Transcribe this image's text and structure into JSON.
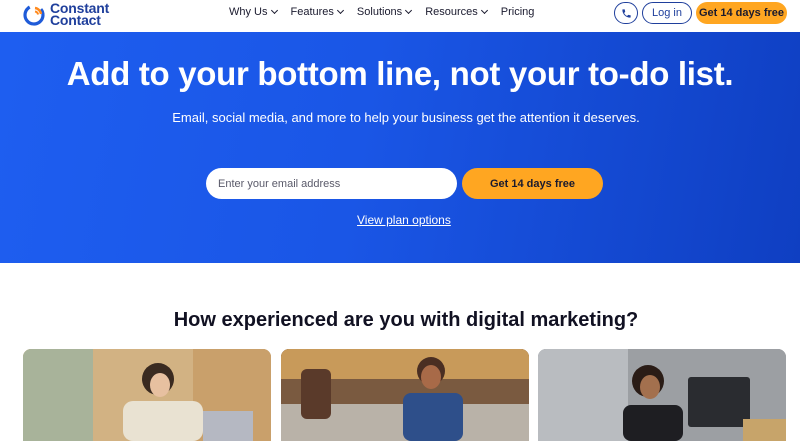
{
  "logo": {
    "line1": "Constant",
    "line2": "Contact"
  },
  "nav": [
    {
      "label": "Why Us",
      "has_dropdown": true
    },
    {
      "label": "Features",
      "has_dropdown": true
    },
    {
      "label": "Solutions",
      "has_dropdown": true
    },
    {
      "label": "Resources",
      "has_dropdown": true
    },
    {
      "label": "Pricing",
      "has_dropdown": false
    }
  ],
  "header": {
    "phone_icon": "phone-icon",
    "login_label": "Log in",
    "trial_label": "Get 14 days free"
  },
  "hero": {
    "title": "Add to your bottom line, not your to-do list.",
    "subtitle": "Email, social media, and more to help your business get the attention it deserves.",
    "email_placeholder": "Enter your email address",
    "cta_label": "Get 14 days free",
    "plan_link": "View plan options"
  },
  "section": {
    "title": "How experienced are you with digital marketing?"
  },
  "colors": {
    "brand_blue": "#1f3f9c",
    "hero_blue": "#1a56e6",
    "accent_orange": "#ffa621"
  }
}
